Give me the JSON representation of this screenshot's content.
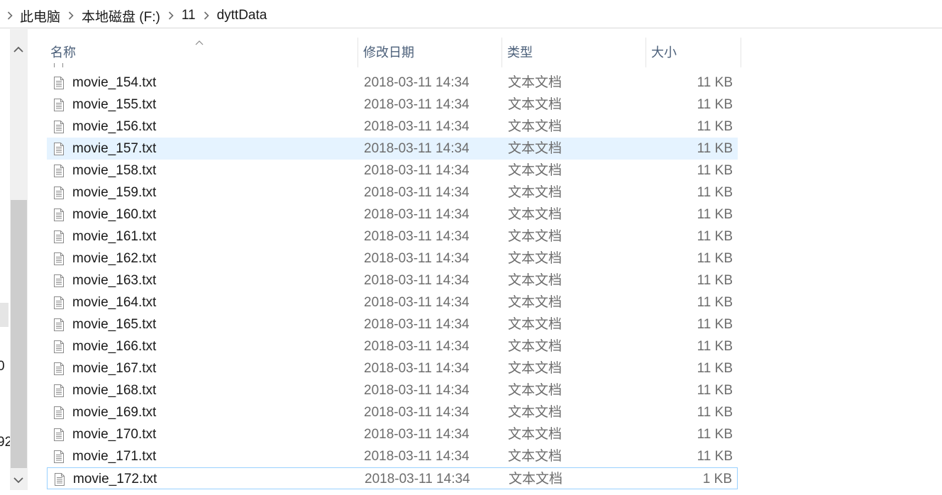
{
  "breadcrumb": {
    "items": [
      "此电脑",
      "本地磁盘 (F:)",
      "11",
      "dyttData"
    ]
  },
  "nav_fragments": [
    "0",
    "92"
  ],
  "columns": {
    "name": "名称",
    "date": "修改日期",
    "type": "类型",
    "size": "大小"
  },
  "files": [
    {
      "name": "movie_154.txt",
      "date": "2018-03-11 14:34",
      "type": "文本文档",
      "size": "11 KB"
    },
    {
      "name": "movie_155.txt",
      "date": "2018-03-11 14:34",
      "type": "文本文档",
      "size": "11 KB"
    },
    {
      "name": "movie_156.txt",
      "date": "2018-03-11 14:34",
      "type": "文本文档",
      "size": "11 KB"
    },
    {
      "name": "movie_157.txt",
      "date": "2018-03-11 14:34",
      "type": "文本文档",
      "size": "11 KB"
    },
    {
      "name": "movie_158.txt",
      "date": "2018-03-11 14:34",
      "type": "文本文档",
      "size": "11 KB"
    },
    {
      "name": "movie_159.txt",
      "date": "2018-03-11 14:34",
      "type": "文本文档",
      "size": "11 KB"
    },
    {
      "name": "movie_160.txt",
      "date": "2018-03-11 14:34",
      "type": "文本文档",
      "size": "11 KB"
    },
    {
      "name": "movie_161.txt",
      "date": "2018-03-11 14:34",
      "type": "文本文档",
      "size": "11 KB"
    },
    {
      "name": "movie_162.txt",
      "date": "2018-03-11 14:34",
      "type": "文本文档",
      "size": "11 KB"
    },
    {
      "name": "movie_163.txt",
      "date": "2018-03-11 14:34",
      "type": "文本文档",
      "size": "11 KB"
    },
    {
      "name": "movie_164.txt",
      "date": "2018-03-11 14:34",
      "type": "文本文档",
      "size": "11 KB"
    },
    {
      "name": "movie_165.txt",
      "date": "2018-03-11 14:34",
      "type": "文本文档",
      "size": "11 KB"
    },
    {
      "name": "movie_166.txt",
      "date": "2018-03-11 14:34",
      "type": "文本文档",
      "size": "11 KB"
    },
    {
      "name": "movie_167.txt",
      "date": "2018-03-11 14:34",
      "type": "文本文档",
      "size": "11 KB"
    },
    {
      "name": "movie_168.txt",
      "date": "2018-03-11 14:34",
      "type": "文本文档",
      "size": "11 KB"
    },
    {
      "name": "movie_169.txt",
      "date": "2018-03-11 14:34",
      "type": "文本文档",
      "size": "11 KB"
    },
    {
      "name": "movie_170.txt",
      "date": "2018-03-11 14:34",
      "type": "文本文档",
      "size": "11 KB"
    },
    {
      "name": "movie_171.txt",
      "date": "2018-03-11 14:34",
      "type": "文本文档",
      "size": "11 KB"
    },
    {
      "name": "movie_172.txt",
      "date": "2018-03-11 14:34",
      "type": "文本文档",
      "size": "1 KB"
    }
  ],
  "hover_row": 3,
  "focused_row": 18,
  "colors": {
    "hover": "#e5f3ff",
    "focus_border": "#99d1ff",
    "header_text": "#4c607a"
  }
}
